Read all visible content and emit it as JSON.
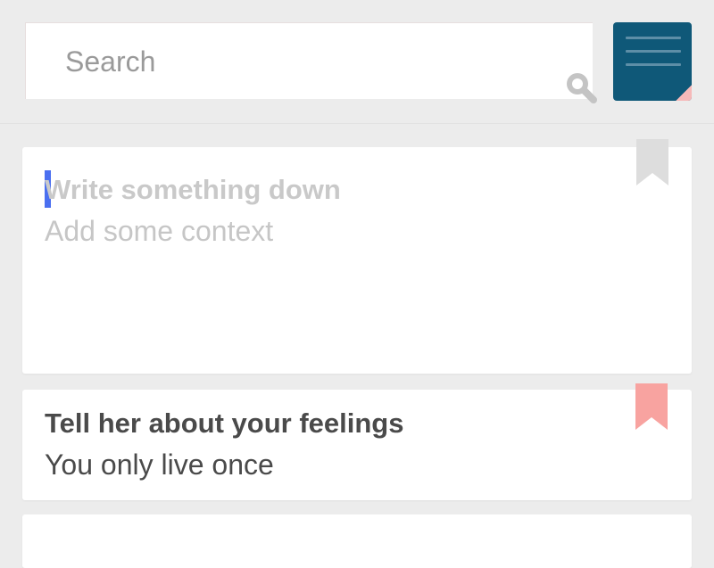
{
  "search": {
    "placeholder": "Search",
    "icon": "search-icon"
  },
  "menu": {
    "icon": "menu-icon",
    "color": "#0f5878",
    "corner_color": "#f4a7a7"
  },
  "editor": {
    "title_placeholder": "Write something down",
    "context_placeholder": "Add some context",
    "bookmark_icon": "bookmark-icon",
    "bookmark_color": "#dddddd",
    "cursor_color": "#4a6ff0"
  },
  "notes": [
    {
      "title": "Tell her about your feelings",
      "subtitle": "You only live once",
      "bookmark_icon": "bookmark-icon",
      "bookmark_color": "#f8a3a0"
    }
  ]
}
